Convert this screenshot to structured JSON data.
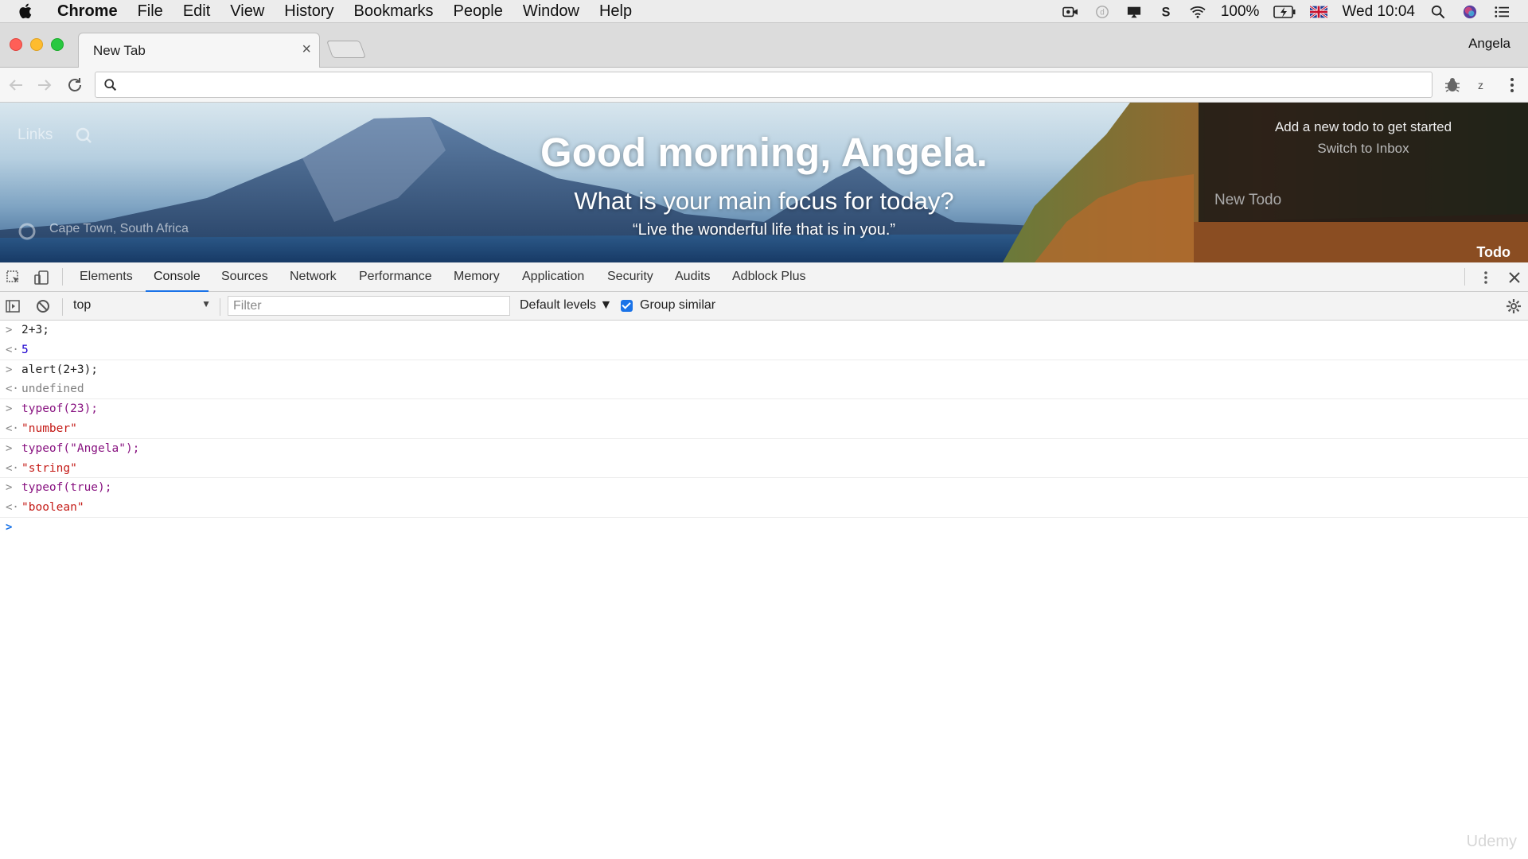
{
  "menubar": {
    "app": "Chrome",
    "items": [
      "File",
      "Edit",
      "View",
      "History",
      "Bookmarks",
      "People",
      "Window",
      "Help"
    ],
    "battery": "100%",
    "clock": "Wed 10:04"
  },
  "browser": {
    "tab_title": "New Tab",
    "tab_close": "×",
    "profile_name": "Angela",
    "omnibox_value": ""
  },
  "newtab_page": {
    "links_label": "Links",
    "greeting": "Good morning, Angela.",
    "focus_prompt": "What is your main focus for today?",
    "quote": "“Live the wonderful life that is in you.”",
    "location": "Cape Town, South Africa",
    "todo": {
      "message": "Add a new todo to get started",
      "switch_label": "Switch to Inbox",
      "input_placeholder": "New Todo",
      "panel_label": "Todo"
    }
  },
  "devtools": {
    "tabs": [
      "Elements",
      "Console",
      "Sources",
      "Network",
      "Performance",
      "Memory",
      "Application",
      "Security",
      "Audits",
      "Adblock Plus"
    ],
    "active_tab": "Console",
    "console_toolbar": {
      "context": "top",
      "filter_placeholder": "Filter",
      "levels": "Default levels ▼",
      "group_similar": "Group similar"
    }
  },
  "console_entries": [
    {
      "type": "input",
      "text": "2+3;"
    },
    {
      "type": "output",
      "text": "5",
      "style": "num"
    },
    {
      "type": "input",
      "text": "alert(2+3);"
    },
    {
      "type": "output",
      "text": "undefined",
      "style": "undef"
    },
    {
      "type": "input",
      "text": "typeof(23);"
    },
    {
      "type": "output",
      "text": "\"number\"",
      "style": "str"
    },
    {
      "type": "input",
      "text": "typeof(\"Angela\");"
    },
    {
      "type": "output",
      "text": "\"string\"",
      "style": "str"
    },
    {
      "type": "input",
      "text": "typeof(true);"
    },
    {
      "type": "output",
      "text": "\"boolean\"",
      "style": "str"
    }
  ],
  "watermark": "Udemy",
  "colors": {
    "accent": "#1a73e8",
    "console_string": "#c41a16",
    "console_number": "#1c00cf",
    "console_keyword": "#881280"
  }
}
